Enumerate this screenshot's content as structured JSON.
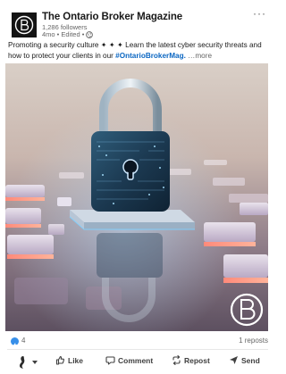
{
  "post": {
    "author": {
      "name": "The Ontario Broker Magazine",
      "followers": "1,286 followers",
      "meta": "4mo • Edited •"
    },
    "more_icon": "more-horizontal-icon",
    "caption": {
      "text": "Promoting a security culture ✦ ✦ ✦ Learn the latest cyber security threats and how to protect your clients in our ",
      "hashtag": "#OntarioBrokerMag.",
      "see_more": " …more"
    },
    "image": {
      "subject": "padlock-on-circuit-board",
      "watermark": "B"
    },
    "social": {
      "reactions": "4",
      "reposts": "1 reposts"
    },
    "actions": [
      {
        "label": "Like",
        "icon": "thumbs-up-icon"
      },
      {
        "label": "Comment",
        "icon": "comment-icon"
      },
      {
        "label": "Repost",
        "icon": "repost-icon"
      },
      {
        "label": "Send",
        "icon": "send-icon"
      }
    ],
    "colors": {
      "link": "#0a66c2",
      "like_badge": "#378fe9",
      "text": "#191919",
      "muted": "#666666"
    }
  }
}
